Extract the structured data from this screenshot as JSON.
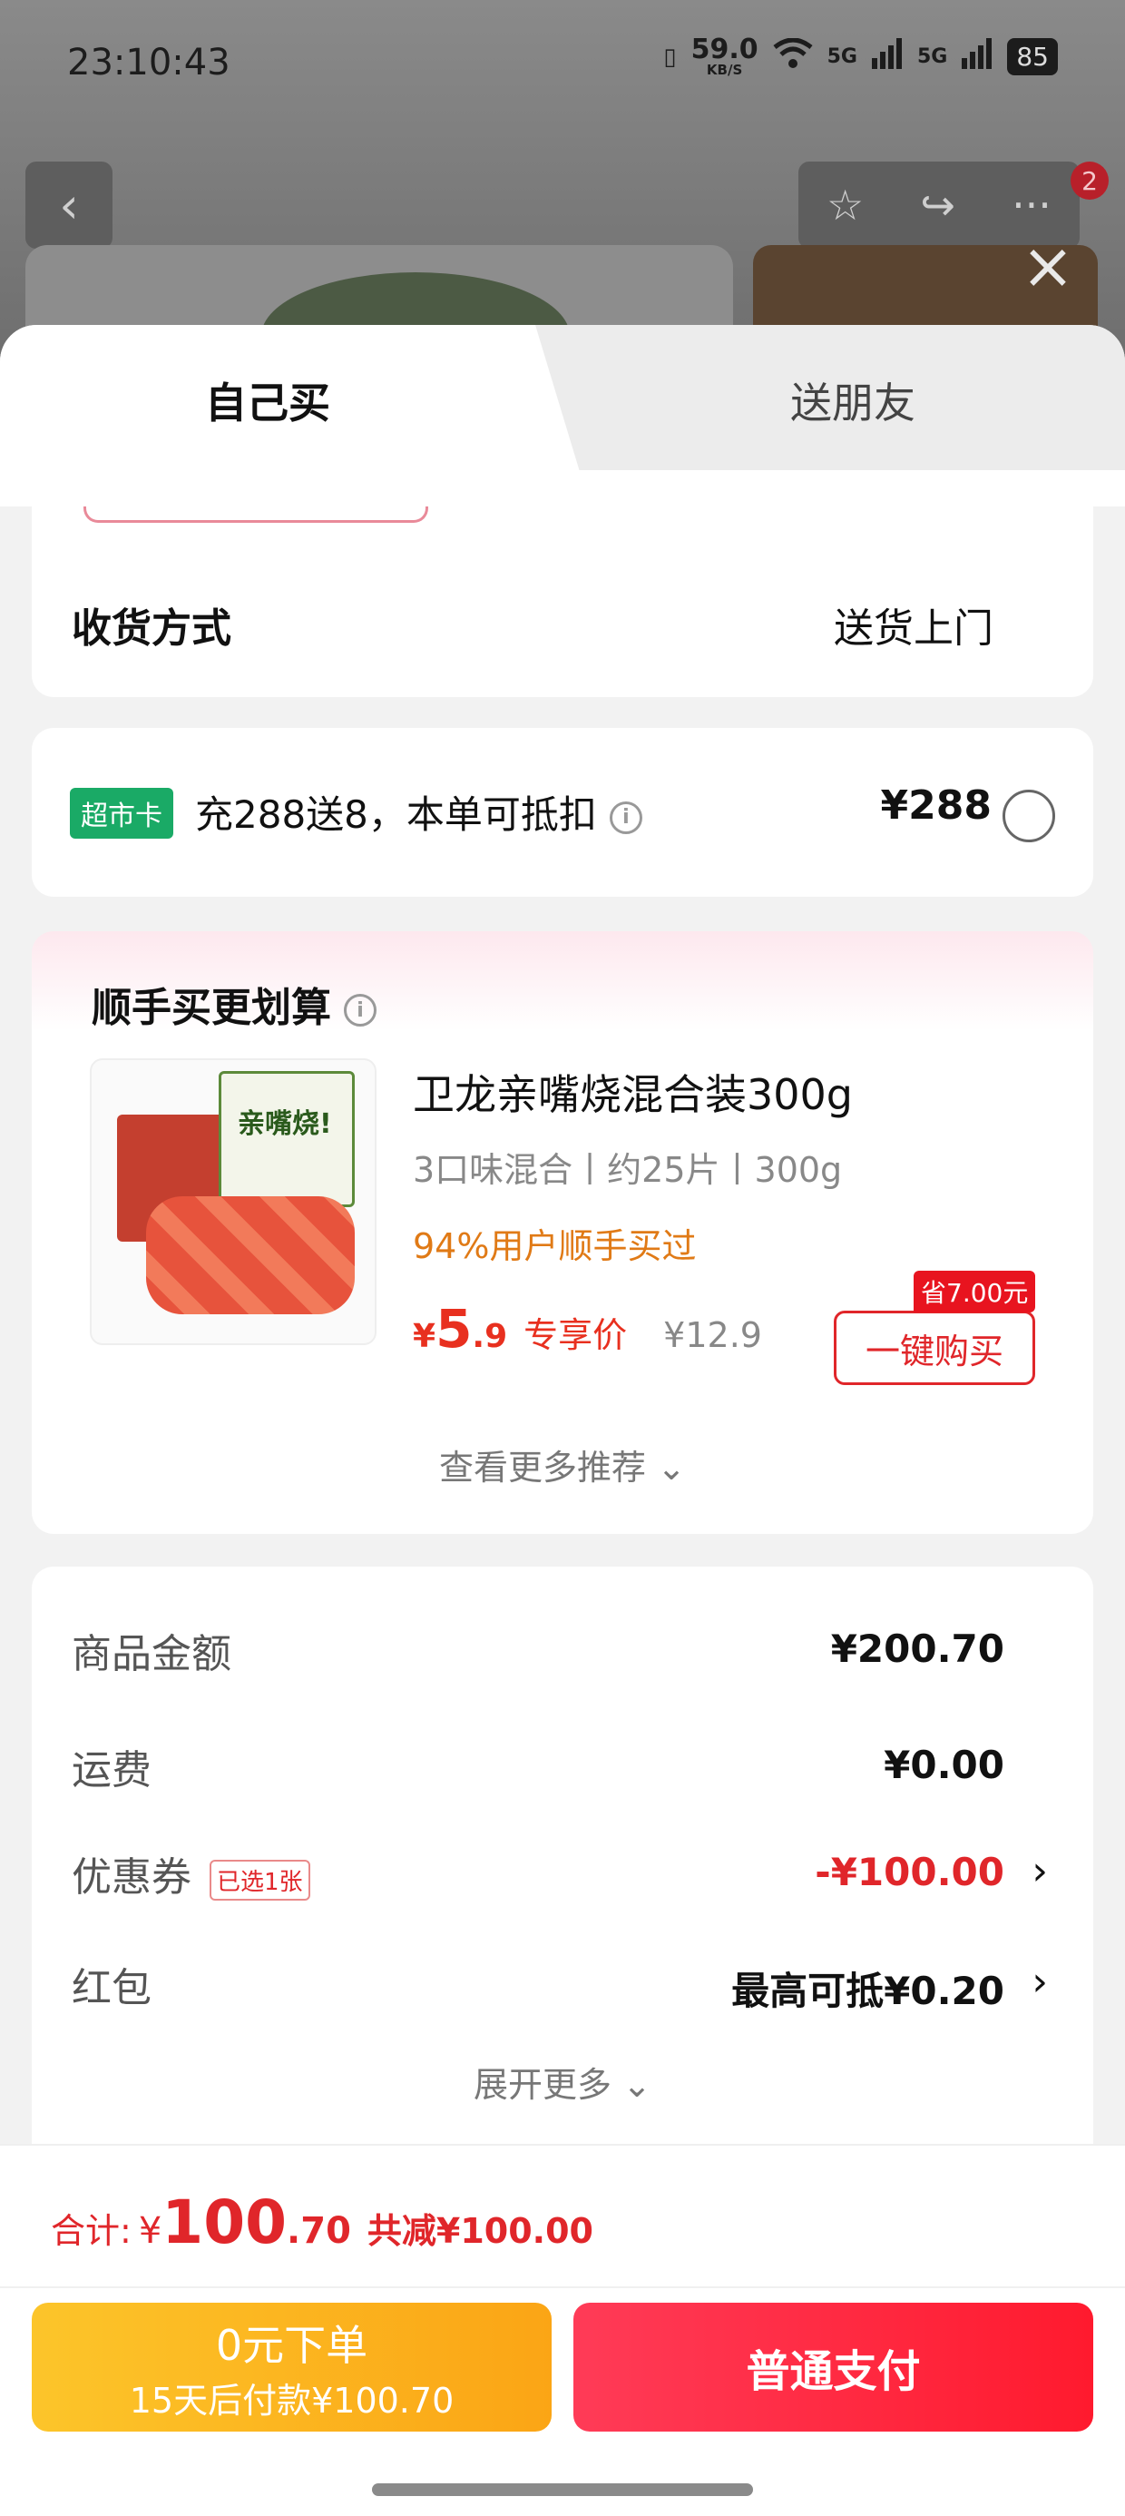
{
  "status_bar": {
    "time": "23:10:43",
    "net_speed": "59.0",
    "net_unit": "KB/S",
    "signal1": "5G",
    "signal2": "5G",
    "battery": "85"
  },
  "header": {
    "back_icon": "chevron-left-icon",
    "cart_badge": "2"
  },
  "tabs": [
    {
      "label": "自己买",
      "active": true
    },
    {
      "label": "送朋友",
      "active": false
    }
  ],
  "delivery": {
    "label": "收货方式",
    "value": "送货上门"
  },
  "supermarket_card": {
    "badge": "超市卡",
    "text": "充288送8，本单可抵扣",
    "price": "¥288"
  },
  "recommend": {
    "title": "顺手买更划算",
    "product": {
      "name": "卫龙亲嘴烧混合装300g",
      "spec": "3口味混合丨约25片丨300g",
      "social": "94%用户顺手买过",
      "price_currency": "¥",
      "price_int": "5",
      "price_dec": ".9",
      "price_tag": "专享价",
      "original_price": "¥12.9",
      "save_tag": "省7.00元",
      "buy_label": "一键购买",
      "package_text": "亲嘴烧!"
    },
    "more_label": "查看更多推荐"
  },
  "summary": {
    "rows": [
      {
        "label": "商品金额",
        "value": "¥200.70"
      },
      {
        "label": "运费",
        "value": "¥0.00"
      },
      {
        "label": "优惠券",
        "tag": "已选1张",
        "value": "-¥100.00"
      },
      {
        "label": "红包",
        "value": "最高可抵¥0.20"
      }
    ],
    "expand_label": "展开更多"
  },
  "footer": {
    "total_label": "合计:",
    "total_currency": "¥",
    "total_int": "100",
    "total_dec": ".70",
    "reduce_text": "共减¥100.00",
    "zero_line1": "0元下单",
    "zero_line2": "15天后付款¥100.70",
    "pay_label": "普通支付"
  },
  "colors": {
    "accent_red": "#e0262a",
    "pay_button": "#ff1a2e",
    "zero_button": "#fba515",
    "badge_green": "#1aaa66"
  }
}
